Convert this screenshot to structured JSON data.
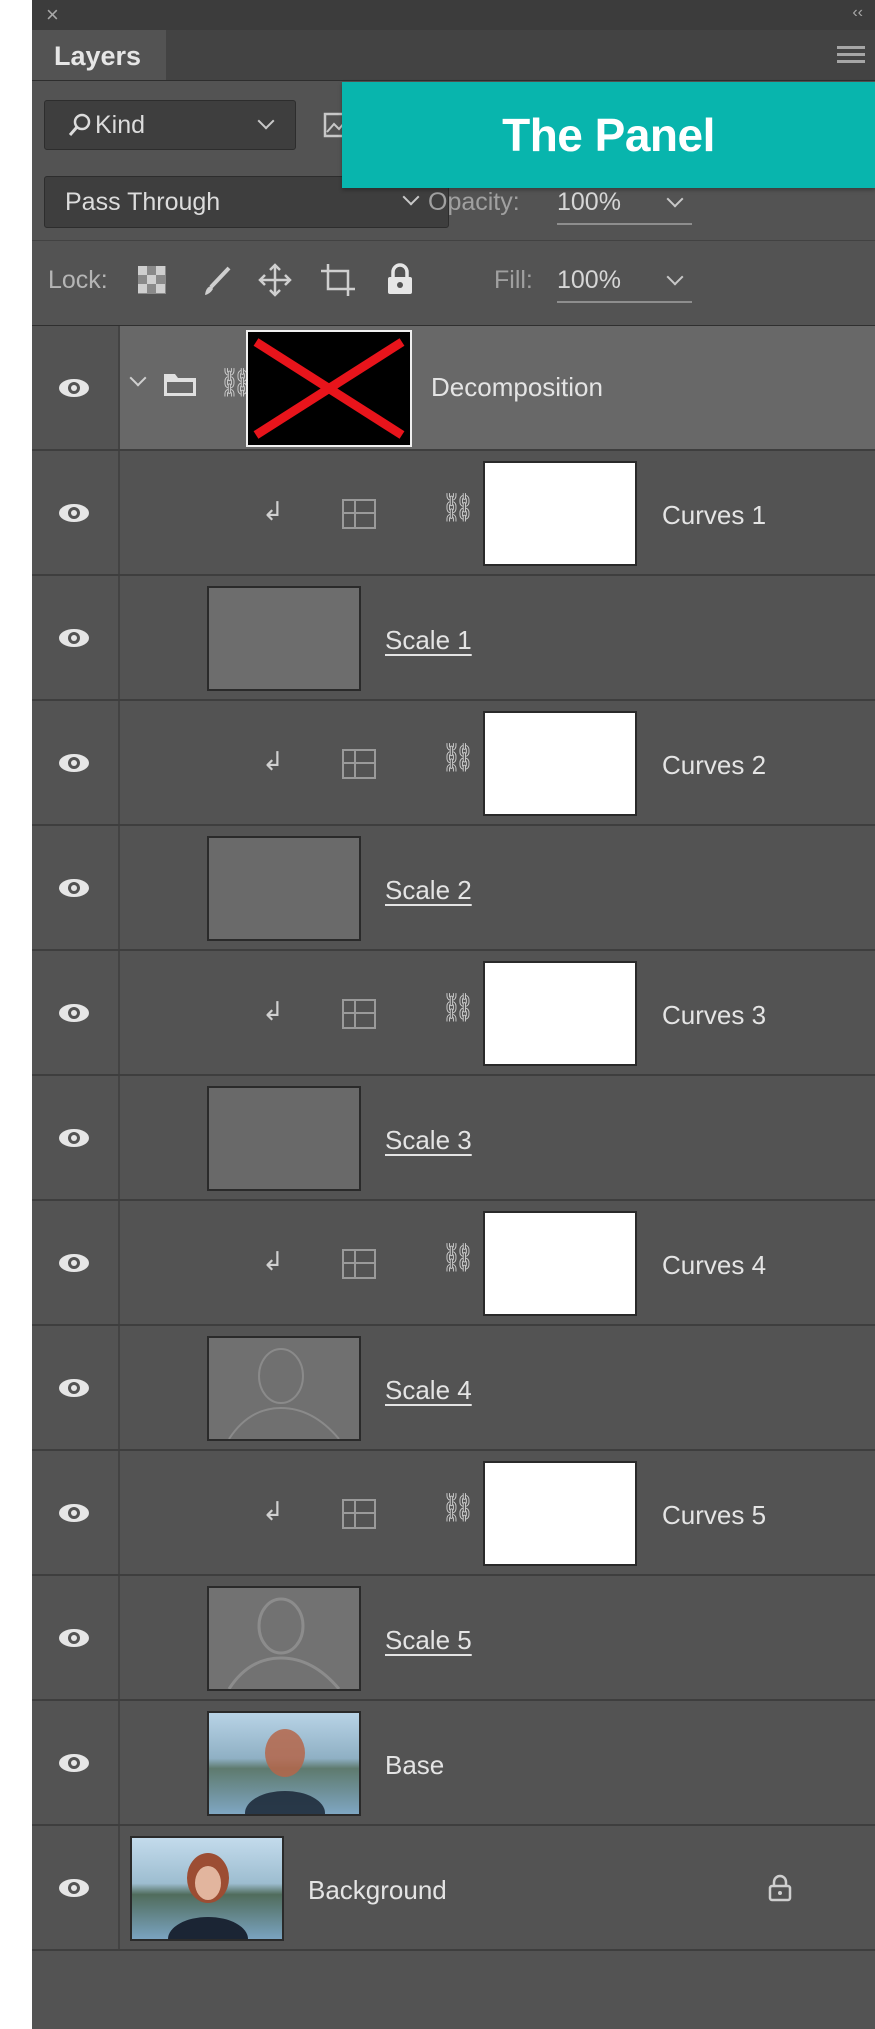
{
  "panel": {
    "tab_label": "Layers",
    "close_glyph": "×",
    "collapse_glyph": "‹‹"
  },
  "banner": {
    "text": "The Panel",
    "color": "#08b5ad"
  },
  "filter": {
    "kind_label": "Kind",
    "search_icon": "search-icon"
  },
  "blend": {
    "mode": "Pass Through",
    "opacity_label": "Opacity:",
    "opacity_value": "100%"
  },
  "lock": {
    "label": "Lock:",
    "fill_label": "Fill:",
    "fill_value": "100%"
  },
  "layers": [
    {
      "name": "Decomposition",
      "type": "group"
    },
    {
      "name": "Curves 1",
      "type": "curves"
    },
    {
      "name": "Scale 1",
      "type": "scale"
    },
    {
      "name": "Curves 2",
      "type": "curves"
    },
    {
      "name": "Scale 2",
      "type": "scale"
    },
    {
      "name": "Curves 3",
      "type": "curves"
    },
    {
      "name": "Scale 3",
      "type": "scale"
    },
    {
      "name": "Curves 4",
      "type": "curves"
    },
    {
      "name": "Scale 4",
      "type": "scale"
    },
    {
      "name": "Curves 5",
      "type": "curves"
    },
    {
      "name": "Scale 5",
      "type": "scale"
    },
    {
      "name": "Base",
      "type": "image"
    },
    {
      "name": "Background",
      "type": "background",
      "locked": true
    }
  ]
}
